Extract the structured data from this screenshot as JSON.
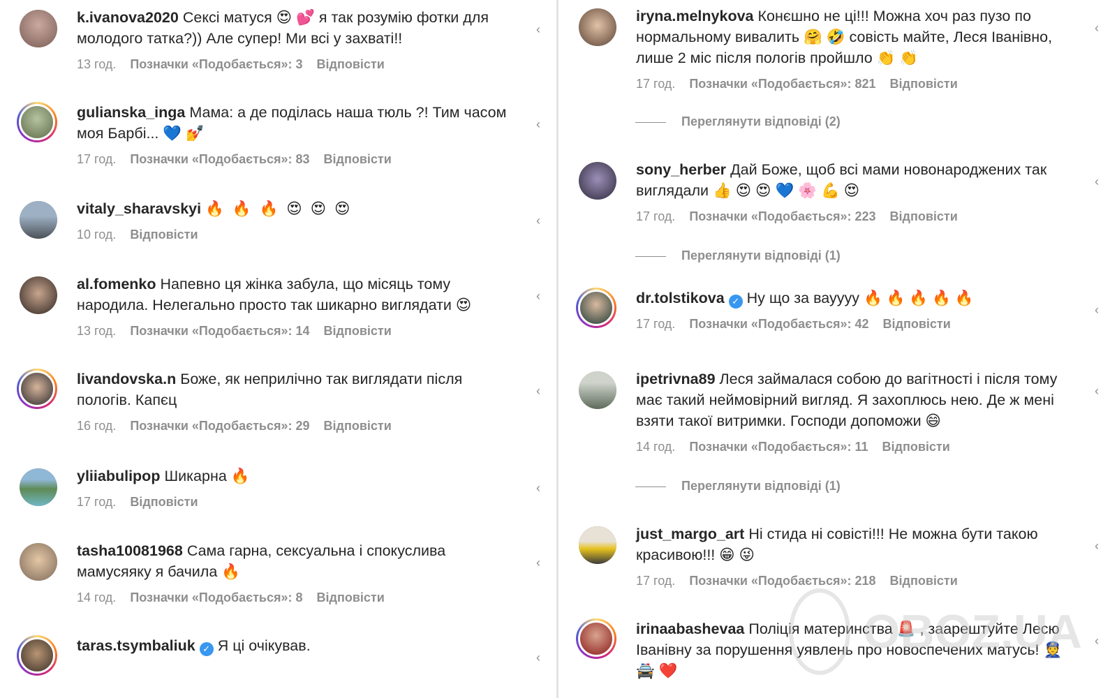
{
  "left_comments": [
    {
      "user": "k.ivanova2020",
      "text": "Сексі матуся 😍 💕 я так розумію фотки для молодого татка?)) Але супер! Ми всі у захваті!!",
      "time": "13 год.",
      "likes": "Позначки «Подобається»: 3",
      "reply": "Відповісти"
    },
    {
      "user": "gulianska_inga",
      "text": "Мама: а де поділась наша тюль ?! Тим часом моя Барбі... 💙 💅",
      "time": "17 год.",
      "likes": "Позначки «Подобається»: 83",
      "reply": "Відповісти"
    },
    {
      "user": "vitaly_sharavskyi",
      "text": "🔥 🔥 🔥 😍 😍 😍",
      "time": "10 год.",
      "reply": "Відповісти"
    },
    {
      "user": "al.fomenko",
      "text": "Напевно ця жінка забула, що місяць тому народила. Нелегально просто так шикарно виглядати 😍",
      "time": "13 год.",
      "likes": "Позначки «Подобається»: 14",
      "reply": "Відповісти"
    },
    {
      "user": "livandovska.n",
      "text": "Боже, як неприлічно так виглядати після пологів. Капєц",
      "time": "16 год.",
      "likes": "Позначки «Подобається»: 29",
      "reply": "Відповісти"
    },
    {
      "user": "yliiabulipop",
      "text": "Шикарна 🔥",
      "time": "17 год.",
      "reply": "Відповісти"
    },
    {
      "user": "tasha10081968",
      "text": "Сама гарна, сексуальна і спокуслива мамусяяку я бачила 🔥",
      "time": "14 год.",
      "likes": "Позначки «Подобається»: 8",
      "reply": "Відповісти"
    },
    {
      "user": "taras.tsymbaliuk",
      "text": "Я ці очікував.",
      "verified": true
    }
  ],
  "right_comments": [
    {
      "user": "iryna.melnykova",
      "text": "Конєшно не ці!!! Можна хоч раз пузо по нормальному вивалить 🤗 🤣 совість майте, Леся Іванівно, лише 2 міс після пологів пройшло 👏 👏",
      "time": "17 год.",
      "likes": "Позначки «Подобається»: 821",
      "reply": "Відповісти",
      "view_replies": "Переглянути відповіді (2)"
    },
    {
      "user": "sony_herber",
      "text": "Дай Боже, щоб всі мами новонароджених так виглядали 👍 😍 😍 💙 🌸 💪 😍",
      "time": "17 год.",
      "likes": "Позначки «Подобається»: 223",
      "reply": "Відповісти",
      "view_replies": "Переглянути відповіді (1)"
    },
    {
      "user": "dr.tolstikova",
      "text": "Ну що за вауууу 🔥 🔥 🔥 🔥 🔥",
      "verified": true,
      "time": "17 год.",
      "likes": "Позначки «Подобається»: 42",
      "reply": "Відповісти"
    },
    {
      "user": "ipetrivna89",
      "text": "Леся займалася собою до вагітності і після тому має такий неймовірний вигляд. Я захоплюсь нею. Де ж мені взяти такої витримки. Господи допоможи 😄",
      "time": "14 год.",
      "likes": "Позначки «Подобається»: 11",
      "reply": "Відповісти",
      "view_replies": "Переглянути відповіді (1)"
    },
    {
      "user": "just_margo_art",
      "text": "Ні стида ні совісті!!! Не можна бути такою красивою!!! 😁 😜",
      "time": "17 год.",
      "likes": "Позначки «Подобається»: 218",
      "reply": "Відповісти"
    },
    {
      "user": "irinaabashevaa",
      "text": "Поліція материнства 🚨 , заарештуйте Лесю Іванівну за порушення уявлень про новоспечених матусь! 👮 🚔 ❤️"
    }
  ],
  "watermark": "OBOZ.UA",
  "colors": {
    "username": "#262626",
    "meta": "#8e8e8e",
    "verified": "#3897f0",
    "divider": "#e3e3e3"
  }
}
